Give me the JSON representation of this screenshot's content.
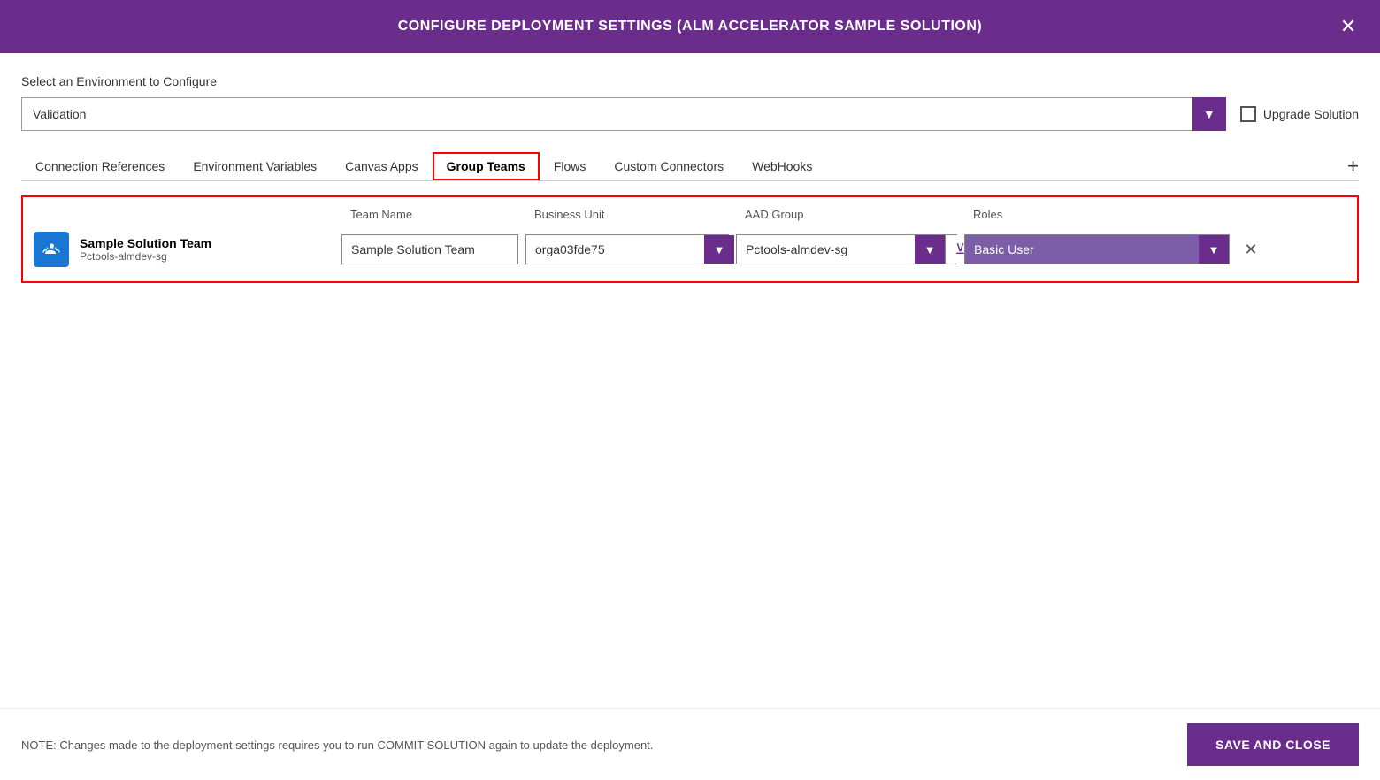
{
  "header": {
    "title": "CONFIGURE DEPLOYMENT SETTINGS (ALM Accelerator Sample Solution)",
    "close_label": "✕"
  },
  "environment": {
    "label": "Select an Environment to Configure",
    "selected": "Validation",
    "dropdown_icon": "▼",
    "upgrade_label": "Upgrade Solution"
  },
  "tabs": [
    {
      "id": "connection-references",
      "label": "Connection References",
      "active": false
    },
    {
      "id": "environment-variables",
      "label": "Environment Variables",
      "active": false
    },
    {
      "id": "canvas-apps",
      "label": "Canvas Apps",
      "active": false
    },
    {
      "id": "group-teams",
      "label": "Group Teams",
      "active": true
    },
    {
      "id": "flows",
      "label": "Flows",
      "active": false
    },
    {
      "id": "custom-connectors",
      "label": "Custom Connectors",
      "active": false
    },
    {
      "id": "webhooks",
      "label": "WebHooks",
      "active": false
    }
  ],
  "add_button_label": "+",
  "table": {
    "columns": {
      "team_info": "",
      "team_name": "Team Name",
      "business_unit": "Business Unit",
      "aad_group": "AAD Group",
      "roles": "Roles"
    },
    "rows": [
      {
        "team_icon_alt": "team-icon",
        "team_name_display": "Sample Solution Team",
        "team_sub": "Pctools-almdev-sg",
        "team_name_value": "Sample Solution Team",
        "business_unit_value": "orga03fde75",
        "aad_group_value": "Pctools-almdev-sg",
        "roles_value": "Basic User"
      }
    ]
  },
  "footer": {
    "note": "NOTE: Changes made to the deployment settings requires you to run COMMIT SOLUTION again to update the deployment.",
    "save_close_label": "SAVE AND CLOSE"
  }
}
